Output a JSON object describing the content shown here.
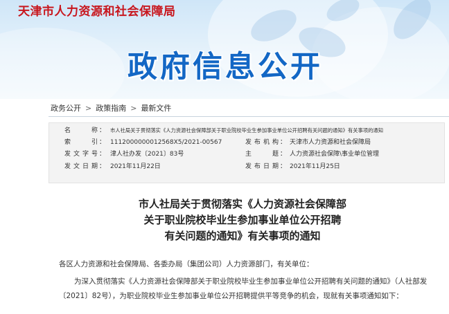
{
  "header": {
    "site_title": "天津市人力资源和社会保障局",
    "page_heading": "政府信息公开"
  },
  "breadcrumb": {
    "items": [
      "政务公开",
      "政策指南",
      "最新文件"
    ],
    "separator": ">"
  },
  "info_table": {
    "name_label": "名　　称",
    "name_value": "市人社局关于贯彻落实《人力资源社会保障部关于职业院校毕业生参加事业单位公开招聘有关问题的通知》有关事项的通知",
    "index_label": "索　　引",
    "index_value": "1112000000012568X5/2021-00567",
    "publisher_label": "发布机构",
    "publisher_value": "天津市人力资源和社会保障局",
    "doc_no_label": "发文字号",
    "doc_no_value": "津人社办发〔2021〕83号",
    "topic_label": "主　　题",
    "topic_value": "人力资源社会保障\\事业单位管理",
    "issue_date_label": "发文日期",
    "issue_date_value": "2021年11月22日",
    "pub_date_label": "发布日期",
    "pub_date_value": "2021年11月25日"
  },
  "document": {
    "title_lines": [
      "市人社局关于贯彻落实《人力资源社会保障部",
      "关于职业院校毕业生参加事业单位公开招聘",
      "有关问题的通知》有关事项的通知"
    ],
    "salutation": "各区人力资源和社会保障局、各委办局（集团公司）人力资源部门，有关单位：",
    "paragraph_1": "为深入贯彻落实《人力资源社会保障部关于职业院校毕业生参加事业单位公开招聘有关问题的通知》（人社部发〔2021〕82号），为职业院校毕业生参加事业单位公开招聘提供平等竞争的机会，现就有关事项通知如下："
  },
  "colors": {
    "site_title": "#c8161d",
    "heading": "#1367c5",
    "table_bg": "#f3f3f3"
  }
}
